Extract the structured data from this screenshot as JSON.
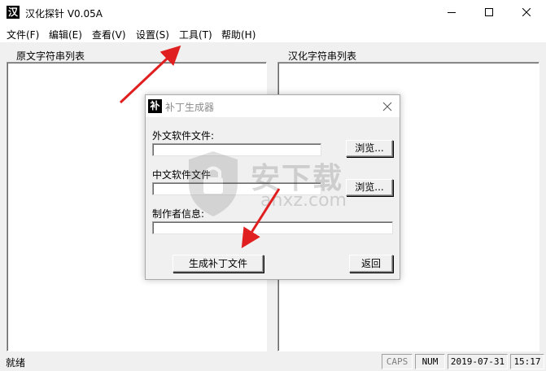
{
  "window": {
    "title": "汉化探针  V0.05A",
    "icon": "zh-app-icon"
  },
  "menu": {
    "items": [
      {
        "label": "文件(F)",
        "id": "file"
      },
      {
        "label": "编辑(E)",
        "id": "edit"
      },
      {
        "label": "查看(V)",
        "id": "view"
      },
      {
        "label": "设置(S)",
        "id": "settings"
      },
      {
        "label": "工具(T)",
        "id": "tools"
      },
      {
        "label": "帮助(H)",
        "id": "help"
      }
    ]
  },
  "panes": {
    "left_title": "原文字符串列表",
    "right_title": "汉化字符串列表"
  },
  "dialog": {
    "icon_glyph": "补",
    "title": "补丁生成器",
    "foreign_label": "外文软件文件:",
    "foreign_value": "",
    "chinese_label": "中文软件文件",
    "chinese_value": "",
    "author_label": "制作者信息:",
    "author_value": "",
    "browse_label": "浏览...",
    "generate_label": "生成补丁文件",
    "back_label": "返回"
  },
  "status": {
    "text": "就绪",
    "caps": "CAPS",
    "num": "NUM",
    "date": "2019-07-31",
    "time": "15:17"
  },
  "watermark": {
    "text_cn": "安下载",
    "text_en": "anxz.com"
  },
  "colors": {
    "accent_arrow": "#e02020",
    "background": "#f0f0f0",
    "title_bar": "#ffffff",
    "dialog_title_text": "#8a8a8a"
  }
}
